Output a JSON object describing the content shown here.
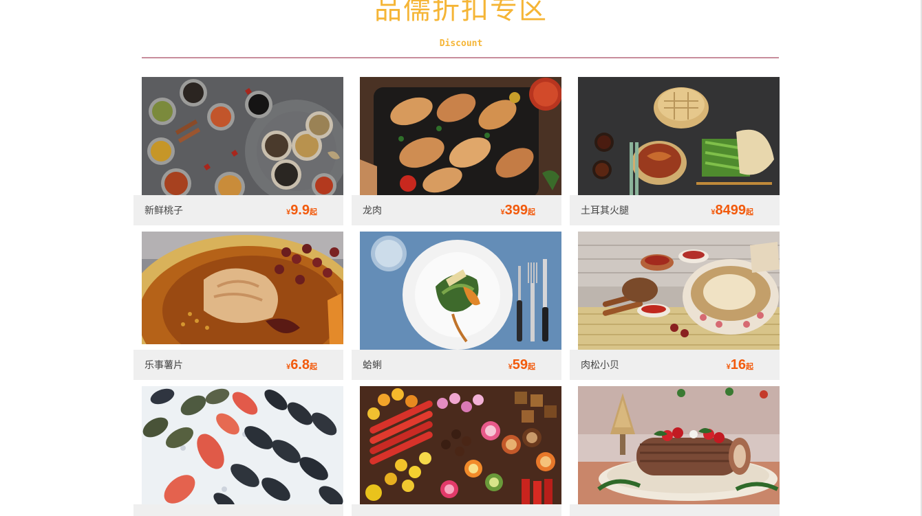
{
  "section": {
    "title": "品儒折扣专区",
    "subtitle": "Discount"
  },
  "colors": {
    "title": "#f5b536",
    "divider": "#c78c9b",
    "price": "#f25a0c",
    "info_bg": "#efefef"
  },
  "products": [
    {
      "name": "新鲜桃子",
      "currency": "¥",
      "price": "9.9",
      "suffix": "起",
      "image": "spices-on-metal-tray"
    },
    {
      "name": "龙肉",
      "currency": "¥",
      "price": "399",
      "suffix": "起",
      "image": "roasted-chicken-drumsticks"
    },
    {
      "name": "土耳其火腿",
      "currency": "¥",
      "price": "8499",
      "suffix": "起",
      "image": "peking-duck-steamer"
    },
    {
      "name": "乐事薯片",
      "currency": "¥",
      "price": "6.8",
      "suffix": "起",
      "image": "spicy-chicken-bowl"
    },
    {
      "name": "蛤蜊",
      "currency": "¥",
      "price": "59",
      "suffix": "起",
      "image": "salad-plate-fork-knife"
    },
    {
      "name": "肉松小贝",
      "currency": "¥",
      "price": "16",
      "suffix": "起",
      "image": "chicken-soup-herbs"
    },
    {
      "name": "",
      "currency": "",
      "price": "",
      "suffix": "",
      "image": "fish-on-ice"
    },
    {
      "name": "",
      "currency": "",
      "price": "",
      "suffix": "",
      "image": "colorful-candies"
    },
    {
      "name": "",
      "currency": "",
      "price": "",
      "suffix": "",
      "image": "yule-log-cake"
    }
  ]
}
